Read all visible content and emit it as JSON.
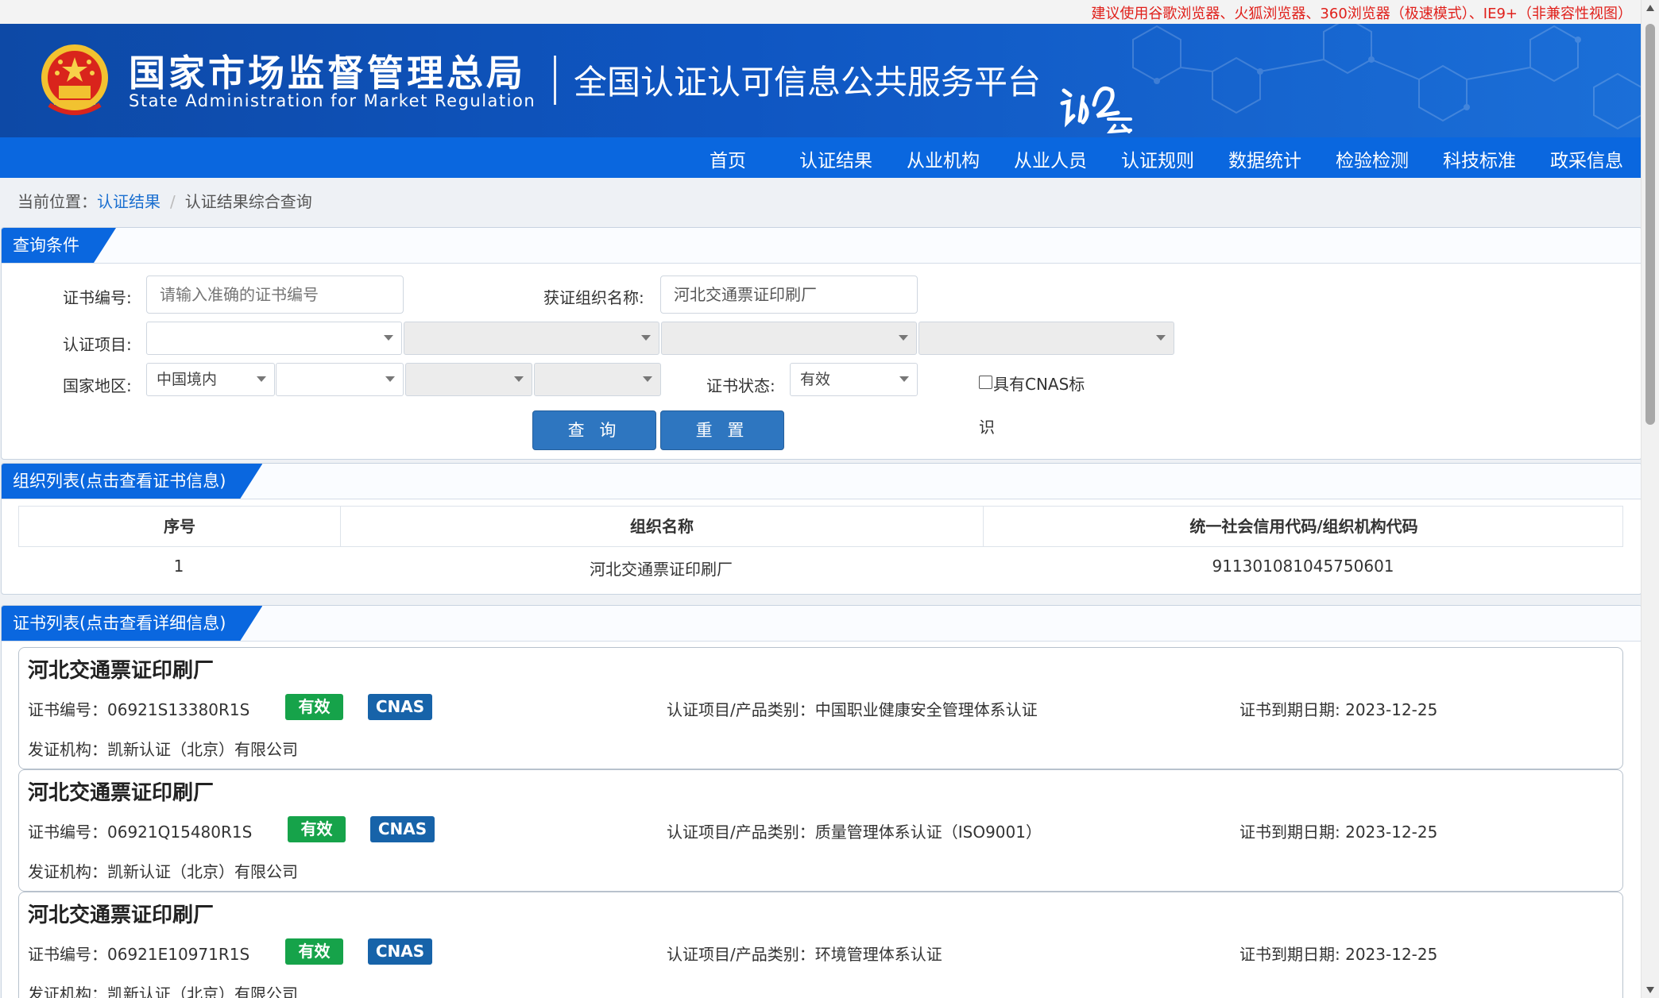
{
  "top_notice": "建议使用谷歌浏览器、火狐浏览器、360浏览器（极速模式）、IE9+（非兼容性视图）",
  "header": {
    "agency_cn": "国家市场监督管理总局",
    "agency_en": "State Administration  for  Market Regulation",
    "platform_title": "全国认证认可信息公共服务平台",
    "emblem_icon": "national-emblem-icon",
    "logo_icon": "renke-cloud-logo-icon"
  },
  "nav": [
    "首页",
    "认证结果",
    "从业机构",
    "从业人员",
    "认证规则",
    "数据统计",
    "检验检测",
    "科技标准",
    "政采信息"
  ],
  "breadcrumb": {
    "prefix": "当前位置：",
    "link": "认证结果",
    "separator": "/",
    "current": "认证结果综合查询"
  },
  "query": {
    "section_title": "查询条件",
    "cert_no_label": "证书编号:",
    "cert_no_placeholder": "请输入准确的证书编号",
    "org_name_label": "获证组织名称:",
    "org_name_value": "河北交通票证印刷厂",
    "cert_item_label": "认证项目:",
    "region_label": "国家地区:",
    "region_value": "中国境内",
    "status_label": "证书状态:",
    "status_value": "有效",
    "cnas_checkbox_label": "具有CNAS标识",
    "search_button": "查 询",
    "reset_button": "重 置"
  },
  "org_list": {
    "section_title": "组织列表(点击查看证书信息)",
    "columns": [
      "序号",
      "组织名称",
      "统一社会信用代码/组织机构代码"
    ],
    "rows": [
      {
        "index": "1",
        "name": "河北交通票证印刷厂",
        "code": "911301081045750601"
      }
    ]
  },
  "cert_list": {
    "section_title": "证书列表(点击查看详细信息)",
    "cert_no_label": "证书编号：",
    "item_label": "认证项目/产品类别：",
    "expiry_label": "证书到期日期: ",
    "issuer_label": "发证机构：",
    "items": [
      {
        "org": "河北交通票证印刷厂",
        "cert_no": "06921S13380R1S",
        "status": "有效",
        "cnas": "CNAS",
        "item": "中国职业健康安全管理体系认证",
        "expiry": "2023-12-25",
        "issuer": "凯新认证（北京）有限公司"
      },
      {
        "org": "河北交通票证印刷厂",
        "cert_no": "06921Q15480R1S",
        "status": "有效",
        "cnas": "CNAS",
        "item": "质量管理体系认证（ISO9001）",
        "expiry": "2023-12-25",
        "issuer": "凯新认证（北京）有限公司"
      },
      {
        "org": "河北交通票证印刷厂",
        "cert_no": "06921E10971R1S",
        "status": "有效",
        "cnas": "CNAS",
        "item": "环境管理体系认证",
        "expiry": "2023-12-25",
        "issuer": "凯新认证（北京）有限公司"
      }
    ]
  },
  "colors": {
    "header_blue": "#0f56c2",
    "nav_blue": "#0a67df",
    "button_blue": "#2e76c0",
    "valid_green": "#16a34a",
    "cnas_blue": "#1763a9",
    "notice_red": "#e0201b"
  }
}
